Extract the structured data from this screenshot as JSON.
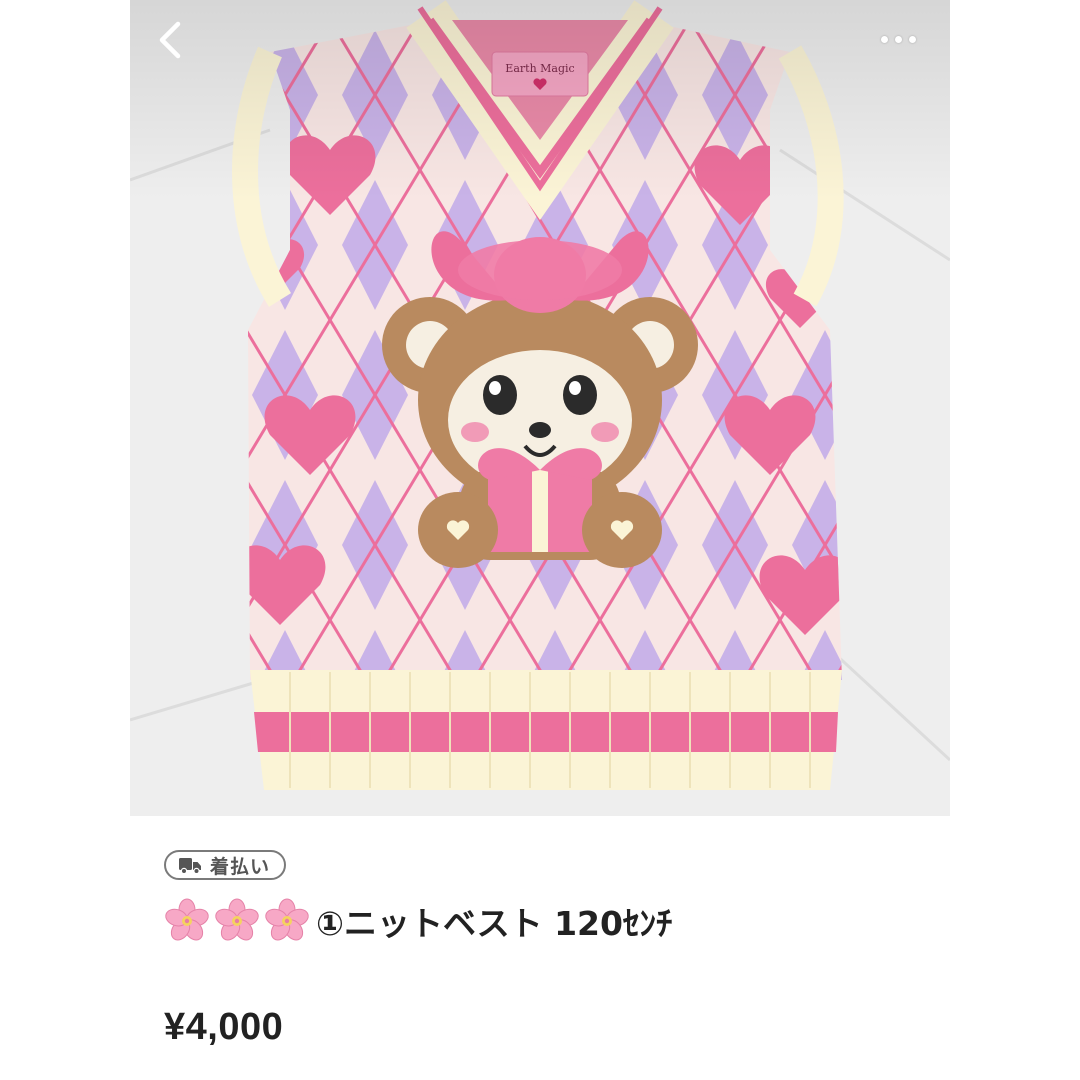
{
  "header": {
    "back_icon": "chevron-left-icon",
    "more_icon": "more-horizontal-icon"
  },
  "photo": {
    "brand_tag_text": "Earth Magic",
    "colors": {
      "cream": "#fbf4d6",
      "pink": "#ec6f9c",
      "lavender": "#c9b3e8",
      "bear_brown": "#b98a5f",
      "background": "#efefef"
    }
  },
  "shipping_badge": {
    "icon": "truck-icon",
    "label": "着払い"
  },
  "item": {
    "flower_icon": "cherry-blossom-icon",
    "flower_count": 3,
    "title": "①ニットベスト 120ｾﾝﾁ",
    "price": "¥4,000"
  }
}
